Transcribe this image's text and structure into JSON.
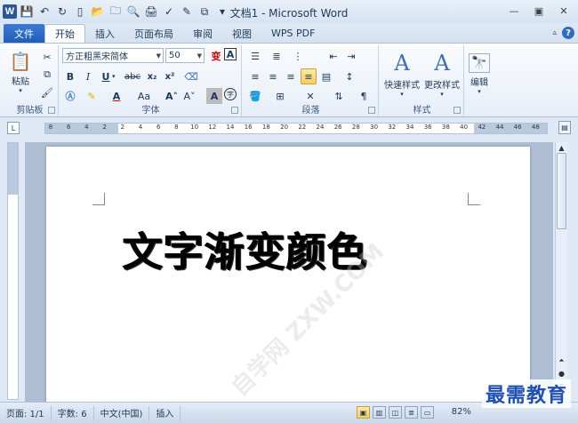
{
  "window": {
    "title": "文档1 - Microsoft Word",
    "app_icon": "W"
  },
  "tabs": {
    "file": "文件",
    "items": [
      "开始",
      "插入",
      "页面布局",
      "审阅",
      "视图",
      "WPS PDF"
    ],
    "active": "开始"
  },
  "ribbon": {
    "clipboard": {
      "paste_label": "粘贴",
      "group_label": "剪贴板"
    },
    "font": {
      "font_name": "方正粗黑宋简体",
      "font_size": "50",
      "group_label": "字体",
      "bold": "B",
      "italic": "I",
      "underline": "U",
      "strikethrough": "abc",
      "subscript": "x₂",
      "superscript": "x²",
      "grow": "A˄",
      "shrink": "A˅",
      "change_case": "Aa",
      "phonetic": "变",
      "char_border": "A",
      "char_shading": "A",
      "enclose": "字"
    },
    "paragraph": {
      "group_label": "段落"
    },
    "styles": {
      "quick_styles": "快速样式",
      "change_styles": "更改样式",
      "group_label": "样式"
    },
    "editing": {
      "label": "编辑"
    }
  },
  "ruler": {
    "ticks": [
      "8",
      "6",
      "4",
      "2",
      "2",
      "4",
      "6",
      "8",
      "10",
      "12",
      "14",
      "16",
      "18",
      "20",
      "22",
      "24",
      "26",
      "28",
      "30",
      "32",
      "34",
      "36",
      "38",
      "40",
      "42",
      "44",
      "46",
      "48"
    ]
  },
  "document": {
    "text": "文字渐变颜色",
    "watermark": "自学网 ZXW.COM"
  },
  "status": {
    "page": "页面: 1/1",
    "words": "字数: 6",
    "language": "中文(中国)",
    "mode": "插入",
    "zoom": "82%"
  },
  "brand": "最需教育",
  "colors": {
    "file_tab": "#2b5fb8",
    "accent": "#2b579a",
    "highlight": "#f8cf5b"
  }
}
